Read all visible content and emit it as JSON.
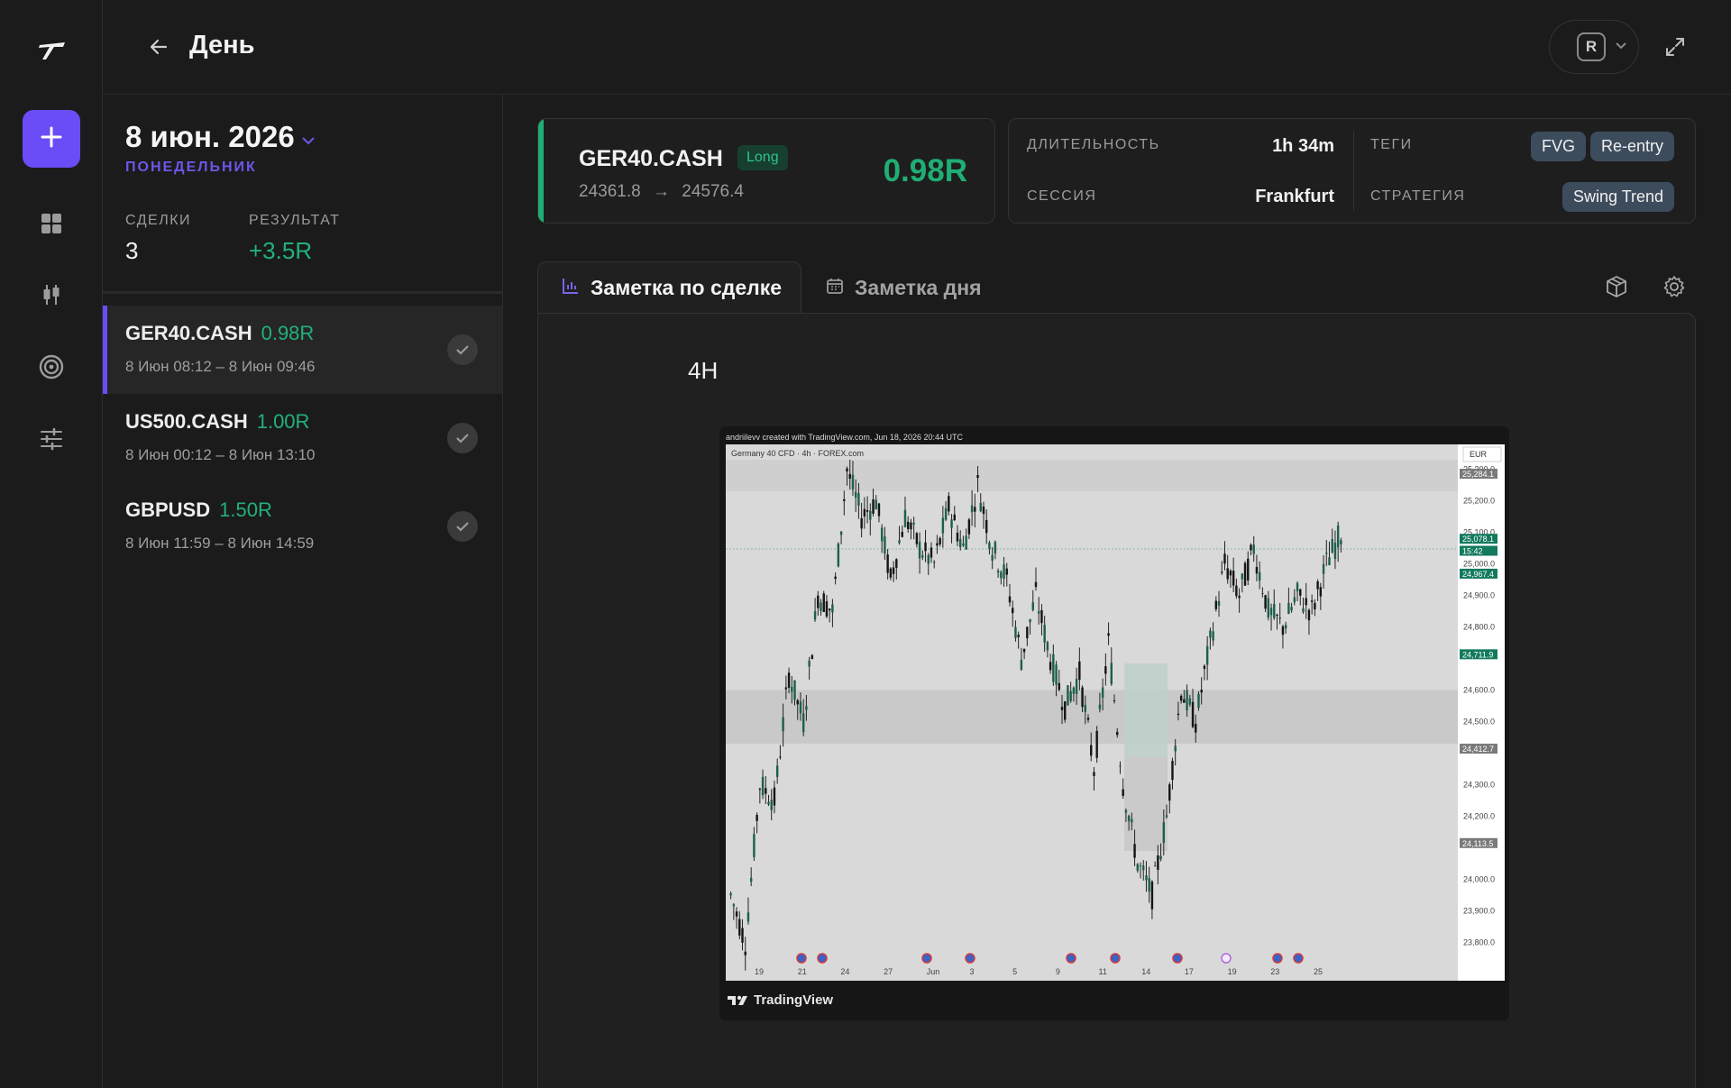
{
  "app": {
    "page_title": "День"
  },
  "rail": {
    "items": [
      "logo-icon",
      "add-icon",
      "dashboard-icon",
      "candles-icon",
      "target-icon",
      "sliders-icon"
    ]
  },
  "header": {
    "r_label": "R"
  },
  "day": {
    "date": "8 июн. 2026",
    "weekday": "ПОНЕДЕЛЬНИК",
    "trades_label": "СДЕЛКИ",
    "trades_value": "3",
    "result_label": "РЕЗУЛЬТАТ",
    "result_value": "+3.5R"
  },
  "trades": [
    {
      "symbol": "GER40.CASH",
      "r": "0.98R",
      "time": "8 Июн 08:12 – 8 Июн 09:46"
    },
    {
      "symbol": "US500.CASH",
      "r": "1.00R",
      "time": "8 Июн 00:12 – 8 Июн 13:10"
    },
    {
      "symbol": "GBPUSD",
      "r": "1.50R",
      "time": "8 Июн 11:59 – 8 Июн 14:59"
    }
  ],
  "trade_card": {
    "symbol": "GER40.CASH",
    "direction": "Long",
    "entry": "24361.8",
    "arrow": "→",
    "exit": "24576.4",
    "r": "0.98R"
  },
  "meta": {
    "duration_label": "ДЛИТЕЛЬНОСТЬ",
    "duration_value": "1h 34m",
    "session_label": "СЕССИЯ",
    "session_value": "Frankfurt",
    "tags_label": "ТЕГИ",
    "tags": [
      "FVG",
      "Re-entry"
    ],
    "strategy_label": "СТРАТЕГИЯ",
    "strategy_value": "Swing Trend"
  },
  "tabs": {
    "trade_note": "Заметка по сделке",
    "day_note": "Заметка дня"
  },
  "note": {
    "heading": "4H",
    "chart_caption": "andriilevv created with TradingView.com, Jun 18, 2026 20:44 UTC",
    "chart_symbol": "Germany 40 CFD · 4h · FOREX.com",
    "currency": "EUR",
    "tv_brand": "TradingView",
    "price_ticks": [
      "25,300.0",
      "25,200.0",
      "25,100.0",
      "25,000.0",
      "24,900.0",
      "24,800.0",
      "24,600.0",
      "24,500.0",
      "24,300.0",
      "24,200.0",
      "24,000.0",
      "23,900.0",
      "23,800.0"
    ],
    "price_labels": [
      {
        "text": "25,284.1",
        "kind": "gray"
      },
      {
        "text": "25,078.1",
        "kind": "green"
      },
      {
        "text": "15:42",
        "kind": "green"
      },
      {
        "text": "24,967.4",
        "kind": "green"
      },
      {
        "text": "24,711.9",
        "kind": "green"
      },
      {
        "text": "24,412.7",
        "kind": "gray"
      },
      {
        "text": "24,113.5",
        "kind": "gray"
      }
    ],
    "date_ticks": [
      "19",
      "21",
      "24",
      "27",
      "Jun",
      "3",
      "5",
      "9",
      "11",
      "14",
      "17",
      "19",
      "23",
      "25"
    ]
  },
  "chart_data": {
    "type": "candlestick",
    "title": "Germany 40 CFD · 4h · FOREX.com",
    "ylim": [
      23750,
      25350
    ],
    "x_ticks": [
      "19",
      "21",
      "24",
      "27",
      "Jun",
      "3",
      "5",
      "9",
      "11",
      "14",
      "17",
      "19",
      "23",
      "25"
    ],
    "trend_points": [
      [
        0,
        23950
      ],
      [
        5,
        23800
      ],
      [
        10,
        24300
      ],
      [
        15,
        24250
      ],
      [
        20,
        24650
      ],
      [
        25,
        24500
      ],
      [
        30,
        24900
      ],
      [
        35,
        24850
      ],
      [
        40,
        25300
      ],
      [
        45,
        25150
      ],
      [
        50,
        25200
      ],
      [
        55,
        24950
      ],
      [
        60,
        25150
      ],
      [
        65,
        25050
      ],
      [
        70,
        25000
      ],
      [
        75,
        25180
      ],
      [
        80,
        25050
      ],
      [
        85,
        25250
      ],
      [
        90,
        25050
      ],
      [
        95,
        24950
      ],
      [
        100,
        24700
      ],
      [
        105,
        24900
      ],
      [
        110,
        24700
      ],
      [
        115,
        24550
      ],
      [
        120,
        24650
      ],
      [
        125,
        24350
      ],
      [
        130,
        24750
      ],
      [
        135,
        24300
      ],
      [
        140,
        24050
      ],
      [
        145,
        23950
      ],
      [
        150,
        24200
      ],
      [
        155,
        24600
      ],
      [
        160,
        24500
      ],
      [
        165,
        24750
      ],
      [
        170,
        25000
      ],
      [
        175,
        24900
      ],
      [
        180,
        25050
      ],
      [
        185,
        24850
      ],
      [
        190,
        24800
      ],
      [
        195,
        24900
      ],
      [
        200,
        24850
      ],
      [
        205,
        25000
      ],
      [
        210,
        25100
      ]
    ],
    "zones": [
      {
        "from": 24430,
        "to": 24600,
        "shade": "mid"
      },
      {
        "from": 25230,
        "to": 25330,
        "shade": "light"
      }
    ]
  }
}
